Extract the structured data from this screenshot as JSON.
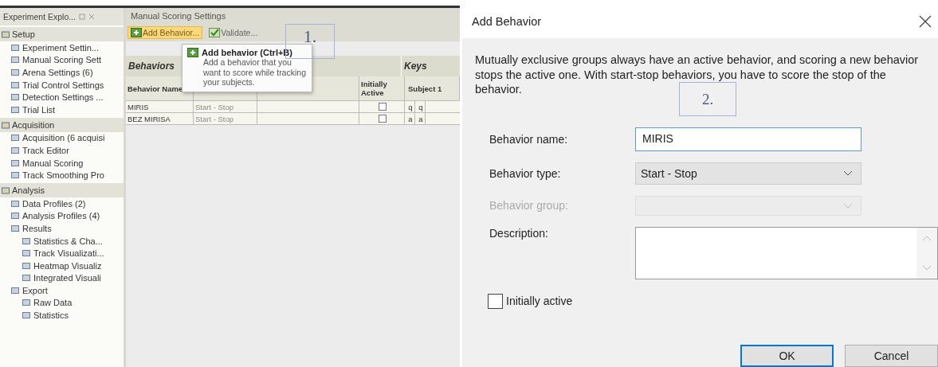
{
  "explorer": {
    "title": "Experiment Explo...",
    "sections": [
      {
        "label": "Setup",
        "children": [
          {
            "label": "Experiment Settin..."
          },
          {
            "label": "Manual Scoring Sett"
          },
          {
            "label": "Arena Settings (6)"
          },
          {
            "label": "Trial Control Settings"
          },
          {
            "label": "Detection Settings ..."
          },
          {
            "label": "Trial List"
          }
        ]
      },
      {
        "label": "Acquisition",
        "children": [
          {
            "label": "Acquisition (6 acquisi"
          },
          {
            "label": "Track Editor"
          },
          {
            "label": "Manual Scoring"
          },
          {
            "label": "Track Smoothing Pro"
          }
        ]
      },
      {
        "label": "Analysis",
        "children": [
          {
            "label": "Data Profiles (2)"
          },
          {
            "label": "Analysis Profiles (4)"
          },
          {
            "label": "Results",
            "children": [
              {
                "label": "Statistics & Cha..."
              },
              {
                "label": "Track Visualizati..."
              },
              {
                "label": "Heatmap Visualiz"
              },
              {
                "label": "Integrated Visuali"
              }
            ]
          },
          {
            "label": "Export",
            "children": [
              {
                "label": "Raw Data"
              },
              {
                "label": "Statistics"
              }
            ]
          }
        ]
      }
    ]
  },
  "settings": {
    "title": "Manual Scoring Settings",
    "toolbar": [
      {
        "label": "Add Behavior...",
        "kind": "add",
        "highlighted": true
      },
      {
        "label": "Validate...",
        "kind": "validate",
        "highlighted": false
      }
    ],
    "callout": "1.",
    "table": {
      "group_headers": [
        "Behaviors",
        "Keys"
      ],
      "columns": [
        "Behavior Name",
        "Initially Active",
        "Subject 1"
      ],
      "rows": [
        {
          "name": "MIRIS",
          "type": "Start - Stop",
          "initially_active": false,
          "keys": [
            "q",
            "q"
          ]
        },
        {
          "name": "BEZ MIRISA",
          "type": "Start - Stop",
          "initially_active": false,
          "keys": [
            "a",
            "a"
          ]
        }
      ]
    },
    "tooltip": {
      "title": "Add behavior (Ctrl+B)",
      "text": "Add a behavior that you want to score while tracking your subjects."
    }
  },
  "dialog": {
    "title": "Add Behavior",
    "intro": "Mutually exclusive groups always have an active behavior, and scoring a new behavior stops the active one. With start-stop behaviors, you have to score the stop of the behavior.",
    "callout": "2.",
    "fields": [
      {
        "label": "Behavior name:",
        "kind": "text",
        "value": "MIRIS",
        "disabled": false
      },
      {
        "label": "Behavior type:",
        "kind": "select",
        "value": "Start - Stop",
        "disabled": false
      },
      {
        "label": "Behavior group:",
        "kind": "select",
        "disabled": true
      },
      {
        "label": "Description:",
        "kind": "textarea",
        "disabled": false
      }
    ],
    "checkbox": {
      "label": "Initially active",
      "checked": false
    },
    "buttons": [
      {
        "label": "OK",
        "default": true
      },
      {
        "label": "Cancel",
        "default": false
      }
    ]
  }
}
